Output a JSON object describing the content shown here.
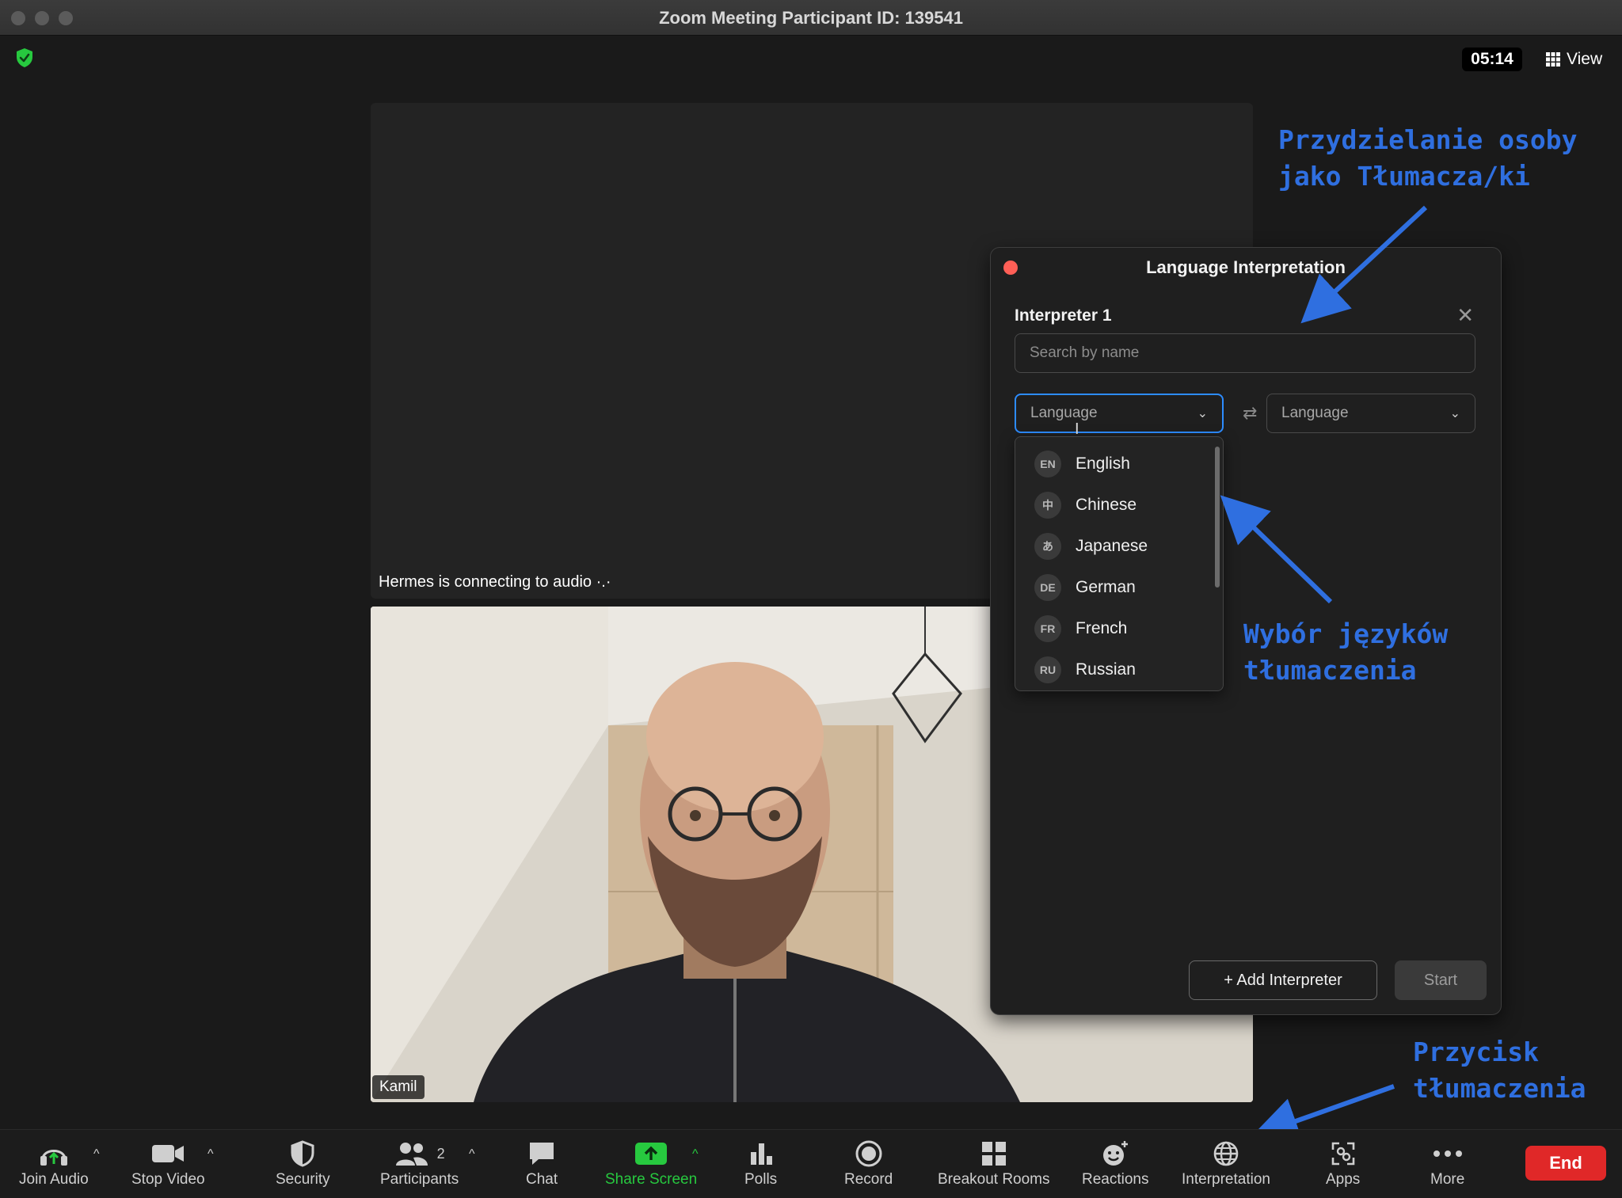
{
  "window": {
    "title": "Zoom Meeting Participant ID: 139541"
  },
  "header": {
    "timer": "05:14",
    "view_label": "View"
  },
  "meeting": {
    "status_text": "Hermes is connecting to audio",
    "participant_name": "Kamil"
  },
  "panel": {
    "title": "Language Interpretation",
    "interpreter_label": "Interpreter 1",
    "search_placeholder": "Search by name",
    "language_from": "Language",
    "language_to": "Language",
    "languages": [
      {
        "code": "EN",
        "name": "English"
      },
      {
        "code": "中",
        "name": "Chinese"
      },
      {
        "code": "あ",
        "name": "Japanese"
      },
      {
        "code": "DE",
        "name": "German"
      },
      {
        "code": "FR",
        "name": "French"
      },
      {
        "code": "RU",
        "name": "Russian"
      }
    ],
    "add_button": "+ Add Interpreter",
    "start_button": "Start"
  },
  "annotations": {
    "assign_line1": "Przydzielanie osoby",
    "assign_line2": "jako Tłumacza/ki",
    "choose_line1": "Wybór języków",
    "choose_line2": "tłumaczenia",
    "button_line1": "Przycisk",
    "button_line2": "tłumaczenia"
  },
  "toolbar": {
    "join_audio": "Join Audio",
    "stop_video": "Stop Video",
    "security": "Security",
    "participants": "Participants",
    "participants_count": "2",
    "chat": "Chat",
    "share_screen": "Share Screen",
    "polls": "Polls",
    "record": "Record",
    "breakout_rooms": "Breakout Rooms",
    "reactions": "Reactions",
    "interpretation": "Interpretation",
    "apps": "Apps",
    "more": "More",
    "end": "End"
  },
  "colors": {
    "accent": "#2d8cff",
    "annotation": "#2f6fe0",
    "end": "#e02828",
    "share": "#27c93f"
  }
}
